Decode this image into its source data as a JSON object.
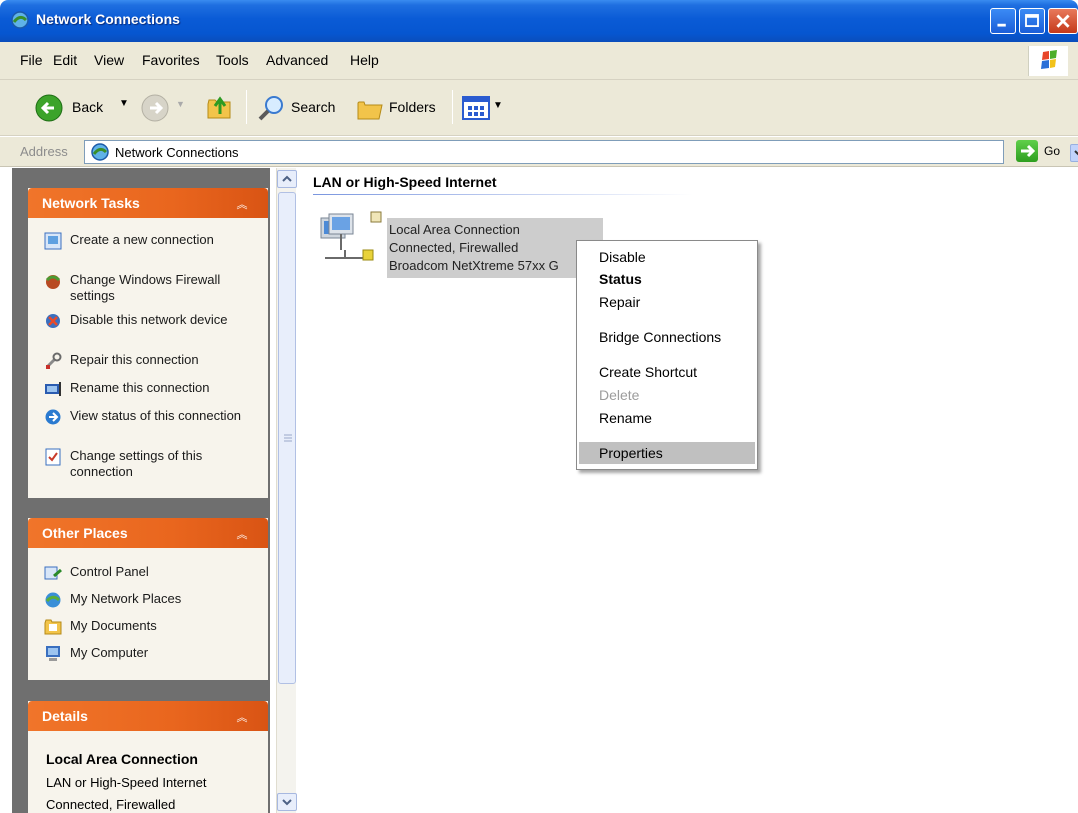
{
  "window": {
    "title": "Network Connections",
    "controls": [
      "minimize-icon",
      "maximize-icon",
      "close-icon"
    ]
  },
  "menubar": {
    "items": [
      "File",
      "Edit",
      "View",
      "Favorites",
      "Tools",
      "Advanced",
      "Help"
    ]
  },
  "toolbar": {
    "back_label": "Back",
    "search_label": "Search",
    "folders_label": "Folders"
  },
  "address": {
    "label": "Address",
    "value": "Network Connections",
    "go_label": "Go"
  },
  "sidebar": {
    "network_tasks": {
      "title": "Network Tasks",
      "items": [
        "Create a new connection",
        "Change Windows Firewall settings",
        "Disable this network device",
        "Repair this connection",
        "Rename this connection",
        "View status of this connection",
        "Change settings of this connection"
      ]
    },
    "other_places": {
      "title": "Other Places",
      "items": [
        "Control Panel",
        "My Network Places",
        "My Documents",
        "My Computer"
      ]
    },
    "details": {
      "title": "Details",
      "name": "Local Area Connection",
      "type": "LAN or High-Speed Internet",
      "status": "Connected, Firewalled"
    }
  },
  "content": {
    "group_heading": "LAN or High-Speed Internet",
    "connection": {
      "name": "Local Area Connection",
      "status": "Connected, Firewalled",
      "device": "Broadcom NetXtreme 57xx G"
    }
  },
  "context_menu": {
    "items": [
      "Disable",
      "Status",
      "Repair",
      "Bridge Connections",
      "Create Shortcut",
      "Delete",
      "Rename",
      "Properties"
    ],
    "default_item": "Status",
    "disabled_item": "Delete",
    "highlighted_item": "Properties"
  },
  "colors": {
    "titlebar": "#0656d0",
    "panel_header": "#e9661e",
    "selection": "#cdcdcd"
  }
}
